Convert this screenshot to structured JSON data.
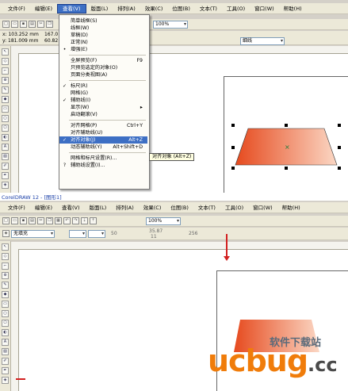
{
  "top": {
    "menus": [
      "文件(F)",
      "编辑(E)",
      "查看(V)",
      "版面(L)",
      "排列(A)",
      "效果(C)",
      "位图(B)",
      "文本(T)",
      "工具(O)",
      "窗口(W)",
      "帮助(H)"
    ],
    "active_menu": "查看(V)",
    "zoom": "100%",
    "coords_x": "x: 103.252 mm",
    "coords_y": "y: 181.009 mm",
    "size_w": "167.0",
    "size_h": "60.82",
    "outline_combo": "细线",
    "tooltip": "对齐对象 (Alt+Z)",
    "view_menu": [
      {
        "label": "简单线框(S)",
        "check": ""
      },
      {
        "label": "线框(W)",
        "check": ""
      },
      {
        "label": "草稿(D)",
        "check": ""
      },
      {
        "label": "正常(N)",
        "check": ""
      },
      {
        "label": "增强(E)",
        "check": "•"
      },
      {
        "sep": true
      },
      {
        "label": "全屏预览(F)",
        "shortcut": "F9",
        "check": ""
      },
      {
        "label": "只预览选定的对象(O)",
        "check": ""
      },
      {
        "label": "页面分类视图(A)",
        "check": ""
      },
      {
        "sep": true
      },
      {
        "label": "标尺(R)",
        "check": "✓"
      },
      {
        "label": "网格(G)",
        "check": ""
      },
      {
        "label": "辅助线(I)",
        "check": "✓"
      },
      {
        "label": "显示(W)",
        "arrow": "▸",
        "check": ""
      },
      {
        "label": "启动翻滚(V)",
        "check": ""
      },
      {
        "sep": true
      },
      {
        "label": "对齐网格(P)",
        "shortcut": "Ctrl+Y",
        "check": ""
      },
      {
        "label": "对齐辅助线(U)",
        "check": ""
      },
      {
        "label": "对齐对象(J)",
        "shortcut": "Alt+Z",
        "check": "✓",
        "highlight": true
      },
      {
        "label": "动态辅助线(Y)",
        "shortcut": "Alt+Shift+D",
        "check": ""
      },
      {
        "sep": true
      },
      {
        "label": "网格和标尺设置(R)...",
        "check": ""
      },
      {
        "label": "辅助线设置(I)...",
        "check": "?"
      }
    ]
  },
  "bottom": {
    "title": "CorelDRAW 12 - [图形1]",
    "menus": [
      "文件(F)",
      "编辑(E)",
      "查看(V)",
      "版面(L)",
      "排列(A)",
      "效果(C)",
      "位图(B)",
      "文本(T)",
      "工具(O)",
      "窗口(W)",
      "帮助(H)"
    ],
    "zoom": "100%",
    "fill_combo": "无填充",
    "nudge": "50",
    "width_val": "35.87",
    "height_val": "11",
    "rotation": "256",
    "watermark_main": "ucbug",
    "watermark_suffix": ".cc",
    "watermark_site": "软件下载站"
  },
  "colors": {
    "shape_left": "#e64a1e",
    "shape_right": "#fbd7c4",
    "menu_highlight": "#3d6fc4",
    "guide_red": "#d22020"
  }
}
